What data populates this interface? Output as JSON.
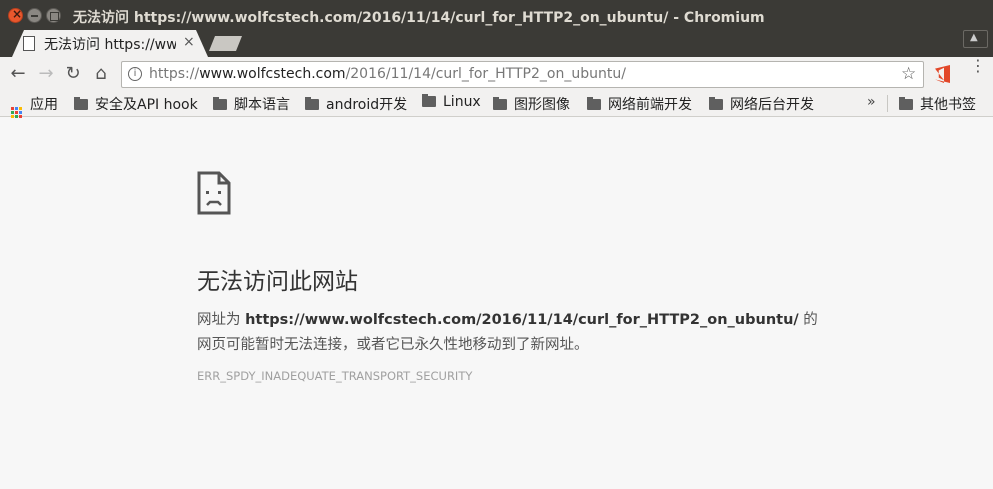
{
  "window": {
    "title": "无法访问 https://www.wolfcstech.com/2016/11/14/curl_for_HTTP2_on_ubuntu/ - Chromium"
  },
  "tab": {
    "title": "无法访问 https://ww",
    "close": "×"
  },
  "toolbar": {
    "back": "←",
    "forward": "→",
    "reload": "↻",
    "home": "⌂",
    "info": "i",
    "url_scheme": "https://",
    "url_host": "www.wolfcstech.com",
    "url_path": "/2016/11/14/curl_for_HTTP2_on_ubuntu/",
    "star": "☆",
    "menu": "⋮"
  },
  "bookmarks": {
    "apps_label": "应用",
    "apps_colors": [
      "#e94235",
      "#4285f4",
      "#fbbc04",
      "#34a853",
      "#e94235",
      "#4285f4",
      "#fbbc04",
      "#34a853",
      "#e94235"
    ],
    "folders": [
      "安全及API hook",
      "脚本语言",
      "android开发",
      "Linux",
      "图形图像",
      "网络前端开发",
      "网络后台开发"
    ],
    "overflow": "»",
    "other": "其他书签"
  },
  "error": {
    "heading": "无法访问此网站",
    "line1_prefix": "网址为 ",
    "line1_url": "https://www.wolfcstech.com/2016/11/14/curl_for_HTTP2_on_ubuntu/",
    "line1_suffix": " 的",
    "line2": "网页可能暂时无法连接，或者它已永久性地移动到了新网址。",
    "code": "ERR_SPDY_INADEQUATE_TRANSPORT_SECURITY"
  }
}
